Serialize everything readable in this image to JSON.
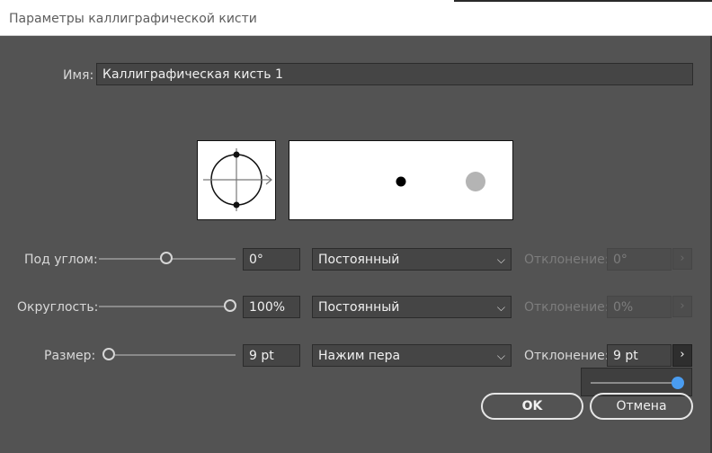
{
  "window": {
    "title": "Параметры каллиграфической кисти"
  },
  "name": {
    "label": "Имя:",
    "value": "Каллиграфическая кисть 1"
  },
  "angle": {
    "label": "Под углом:",
    "value": "0°",
    "mode": "Постоянный",
    "variation_label": "Отклонение:",
    "variation_value": "0°"
  },
  "roundness": {
    "label": "Округлость:",
    "value": "100%",
    "mode": "Постоянный",
    "variation_label": "Отклонение:",
    "variation_value": "0%"
  },
  "size": {
    "label": "Размер:",
    "value": "9 pt",
    "mode": "Нажим пера",
    "variation_label": "Отклонение:",
    "variation_value": "9 pt"
  },
  "buttons": {
    "ok": "OK",
    "cancel": "Отмена"
  },
  "icons": {
    "dropdown": "chevron-down-icon",
    "step": "chevron-right-icon"
  },
  "colors": {
    "accent": "#4a9cf0",
    "panel": "#535353",
    "field": "#454545"
  }
}
